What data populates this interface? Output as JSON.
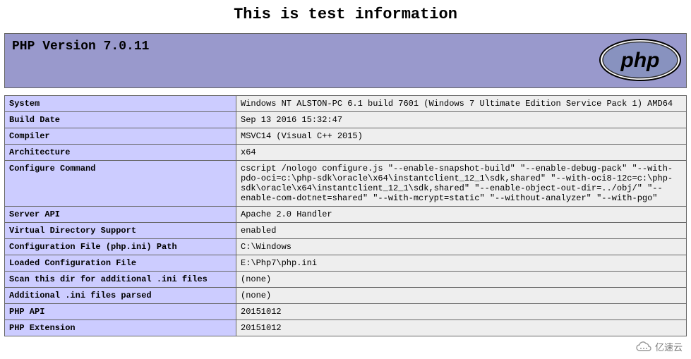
{
  "title": "This is test information",
  "header": {
    "version_label": "PHP Version 7.0.11",
    "logo_text": "php"
  },
  "rows": [
    {
      "key": "System",
      "value": "Windows NT ALSTON-PC 6.1 build 7601 (Windows 7 Ultimate Edition Service Pack 1) AMD64"
    },
    {
      "key": "Build Date",
      "value": "Sep 13 2016 15:32:47"
    },
    {
      "key": "Compiler",
      "value": "MSVC14 (Visual C++ 2015)"
    },
    {
      "key": "Architecture",
      "value": "x64"
    },
    {
      "key": "Configure Command",
      "value": "cscript /nologo configure.js \"--enable-snapshot-build\" \"--enable-debug-pack\" \"--with-pdo-oci=c:\\php-sdk\\oracle\\x64\\instantclient_12_1\\sdk,shared\" \"--with-oci8-12c=c:\\php-sdk\\oracle\\x64\\instantclient_12_1\\sdk,shared\" \"--enable-object-out-dir=../obj/\" \"--enable-com-dotnet=shared\" \"--with-mcrypt=static\" \"--without-analyzer\" \"--with-pgo\""
    },
    {
      "key": "Server API",
      "value": "Apache 2.0 Handler"
    },
    {
      "key": "Virtual Directory Support",
      "value": "enabled"
    },
    {
      "key": "Configuration File (php.ini) Path",
      "value": "C:\\Windows"
    },
    {
      "key": "Loaded Configuration File",
      "value": "E:\\Php7\\php.ini"
    },
    {
      "key": "Scan this dir for additional .ini files",
      "value": "(none)"
    },
    {
      "key": "Additional .ini files parsed",
      "value": "(none)"
    },
    {
      "key": "PHP API",
      "value": "20151012"
    },
    {
      "key": "PHP Extension",
      "value": "20151012"
    }
  ],
  "watermark": {
    "text": "亿速云"
  }
}
